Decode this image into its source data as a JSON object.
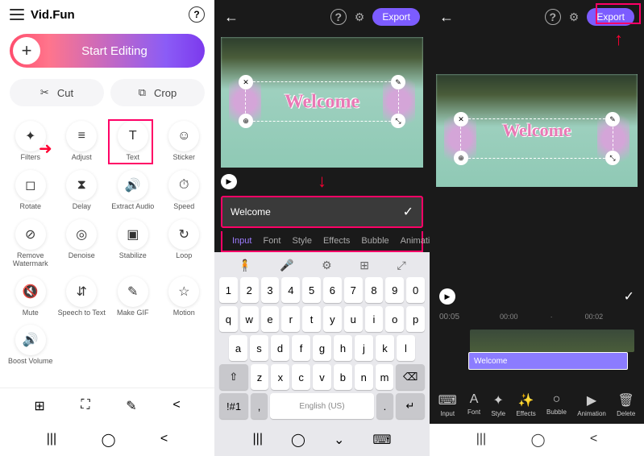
{
  "panel1": {
    "appName": "Vid.Fun",
    "startEditing": "Start Editing",
    "cut": "Cut",
    "crop": "Crop",
    "tools": [
      {
        "label": "Filters",
        "icon": "✦"
      },
      {
        "label": "Adjust",
        "icon": "≡"
      },
      {
        "label": "Text",
        "icon": "T"
      },
      {
        "label": "Sticker",
        "icon": "☺"
      },
      {
        "label": "Rotate",
        "icon": "◻"
      },
      {
        "label": "Delay",
        "icon": "⧗"
      },
      {
        "label": "Extract Audio",
        "icon": "🔊"
      },
      {
        "label": "Speed",
        "icon": "⏱"
      },
      {
        "label": "Remove Watermark",
        "icon": "⊘"
      },
      {
        "label": "Denoise",
        "icon": "◎"
      },
      {
        "label": "Stabilize",
        "icon": "▣"
      },
      {
        "label": "Loop",
        "icon": "↻"
      },
      {
        "label": "Mute",
        "icon": "🔇"
      },
      {
        "label": "Speech to Text",
        "icon": "⇵"
      },
      {
        "label": "Make GIF",
        "icon": "✎"
      },
      {
        "label": "Motion",
        "icon": "☆"
      },
      {
        "label": "Boost Volume",
        "icon": "🔊"
      }
    ]
  },
  "panel2": {
    "export": "Export",
    "previewText": "Welcome",
    "inputValue": "Welcome",
    "tabs": [
      "Input",
      "Font",
      "Style",
      "Effects",
      "Bubble",
      "Animation"
    ],
    "keyboard": {
      "row1": [
        "1",
        "2",
        "3",
        "4",
        "5",
        "6",
        "7",
        "8",
        "9",
        "0"
      ],
      "row2": [
        "q",
        "w",
        "e",
        "r",
        "t",
        "y",
        "u",
        "i",
        "o",
        "p"
      ],
      "row3": [
        "a",
        "s",
        "d",
        "f",
        "g",
        "h",
        "j",
        "k",
        "l"
      ],
      "row4": [
        "z",
        "x",
        "c",
        "v",
        "b",
        "n",
        "m"
      ],
      "special": "!#1",
      "lang": "English (US)"
    }
  },
  "panel3": {
    "export": "Export",
    "previewText": "Welcome",
    "time": "00:05",
    "ruler": [
      "00:00",
      "00:02"
    ],
    "clipLabel": "Welcome",
    "bottomTools": [
      {
        "label": "Input",
        "icon": "⌨"
      },
      {
        "label": "Font",
        "icon": "A"
      },
      {
        "label": "Style",
        "icon": "✦"
      },
      {
        "label": "Effects",
        "icon": "✨"
      },
      {
        "label": "Bubble",
        "icon": "○"
      },
      {
        "label": "Animation",
        "icon": "▶"
      },
      {
        "label": "Delete",
        "icon": "🗑"
      }
    ]
  }
}
